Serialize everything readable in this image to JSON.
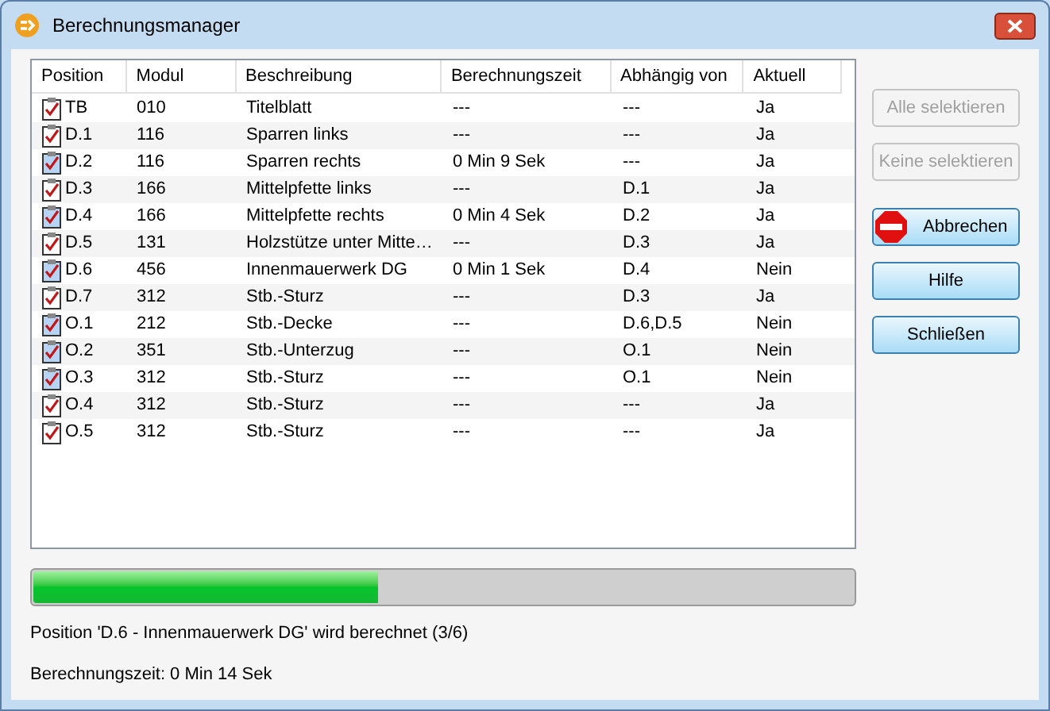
{
  "window": {
    "title": "Berechnungsmanager"
  },
  "table": {
    "columns": [
      "Position",
      "Modul",
      "Beschreibung",
      "Berechnungszeit",
      "Abhängig von",
      "Aktuell"
    ],
    "rows": [
      {
        "marked": false,
        "cells": [
          "TB",
          "010",
          "Titelblatt",
          "---",
          "---",
          "Ja"
        ]
      },
      {
        "marked": false,
        "cells": [
          "D.1",
          "116",
          "Sparren links",
          "---",
          "---",
          "Ja"
        ]
      },
      {
        "marked": true,
        "cells": [
          "D.2",
          "116",
          "Sparren rechts",
          "0 Min 9 Sek",
          "---",
          "Ja"
        ]
      },
      {
        "marked": false,
        "cells": [
          "D.3",
          "166",
          "Mittelpfette links",
          "---",
          "D.1",
          "Ja"
        ]
      },
      {
        "marked": true,
        "cells": [
          "D.4",
          "166",
          "Mittelpfette rechts",
          "0 Min 4 Sek",
          "D.2",
          "Ja"
        ]
      },
      {
        "marked": false,
        "cells": [
          "D.5",
          "131",
          "Holzstütze unter Mitte…",
          "---",
          "D.3",
          "Ja"
        ]
      },
      {
        "marked": true,
        "cells": [
          "D.6",
          "456",
          "Innenmauerwerk DG",
          "0 Min 1 Sek",
          "D.4",
          "Nein"
        ]
      },
      {
        "marked": false,
        "cells": [
          "D.7",
          "312",
          "Stb.-Sturz",
          "---",
          "D.3",
          "Ja"
        ]
      },
      {
        "marked": true,
        "cells": [
          "O.1",
          "212",
          "Stb.-Decke",
          "---",
          "D.6,D.5",
          "Nein"
        ]
      },
      {
        "marked": true,
        "cells": [
          "O.2",
          "351",
          "Stb.-Unterzug",
          "---",
          "O.1",
          "Nein"
        ]
      },
      {
        "marked": true,
        "cells": [
          "O.3",
          "312",
          "Stb.-Sturz",
          "---",
          "O.1",
          "Nein"
        ]
      },
      {
        "marked": false,
        "cells": [
          "O.4",
          "312",
          "Stb.-Sturz",
          "---",
          "---",
          "Ja"
        ]
      },
      {
        "marked": false,
        "cells": [
          "O.5",
          "312",
          "Stb.-Sturz",
          "---",
          "---",
          "Ja"
        ]
      }
    ]
  },
  "buttons": [
    {
      "label": "Alle selektieren",
      "disabled": true,
      "kind": "plain"
    },
    {
      "label": "Keine selektieren",
      "disabled": true,
      "kind": "plain"
    },
    {
      "label": "Abbrechen",
      "disabled": false,
      "kind": "stop"
    },
    {
      "label": "Hilfe",
      "disabled": false,
      "kind": "plain"
    },
    {
      "label": "Schließen",
      "disabled": false,
      "kind": "plain"
    }
  ],
  "progress": {
    "level": 0.42
  },
  "status": "Position 'D.6 - Innenmauerwerk DG' wird berechnet (3/6)",
  "time": "Berechnungszeit: 0 Min 14 Sek"
}
